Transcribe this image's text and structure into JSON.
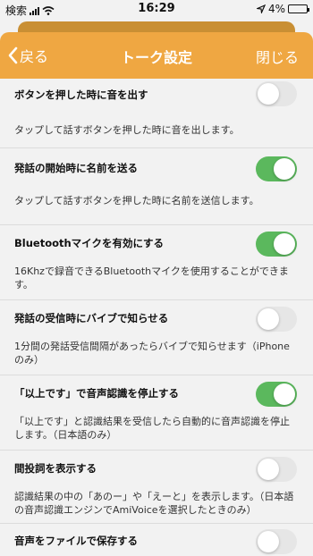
{
  "status_bar": {
    "carrier": "検索",
    "time": "16:29",
    "battery": "4%",
    "battery_level": 0.04,
    "icons": [
      "signal-icon",
      "wifi-icon",
      "location-icon",
      "battery-icon"
    ]
  },
  "nav": {
    "back_label": "戻る",
    "title": "トーク設定",
    "close_label": "閉じる",
    "accent_color": "#efa742"
  },
  "settings": [
    {
      "title": "ボタンを押した時に音を出す",
      "desc": "タップして話すボタンを押した時に音を出します。",
      "on": false
    },
    {
      "title": "発話の開始時に名前を送る",
      "desc": "タップして話すボタンを押した時に名前を送信します。",
      "on": true
    },
    {
      "title": "Bluetoothマイクを有効にする",
      "desc": "16Khzで録音できるBluetoothマイクを使用することができます。",
      "on": true
    },
    {
      "title": "発話の受信時にバイブで知らせる",
      "desc": "1分間の発話受信間隔があったらバイブで知らせます（iPhoneのみ）",
      "on": false
    },
    {
      "title": "「以上です」で音声認識を停止する",
      "desc": "「以上です」と認識結果を受信したら自動的に音声認識を停止します。（日本語のみ）",
      "on": true
    },
    {
      "title": "間投詞を表示する",
      "desc": "認識結果の中の「あのー」や「えーと」を表示します。（日本語の音声認識エンジンでAmiVoiceを選択したときのみ）",
      "on": false
    },
    {
      "title": "音声をファイルで保存する",
      "desc": "",
      "on": false
    }
  ],
  "colors": {
    "toggle_on": "#5bb85d",
    "toggle_off": "#e6e6e6"
  }
}
